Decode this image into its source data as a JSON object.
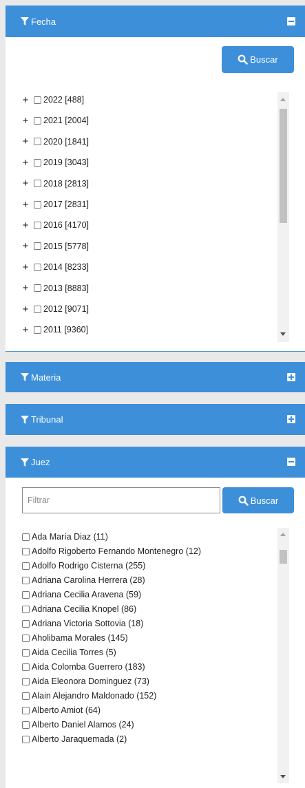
{
  "sections": {
    "fecha": {
      "title": "Fecha"
    },
    "materia": {
      "title": "Materia"
    },
    "tribunal": {
      "title": "Tribunal"
    },
    "juez": {
      "title": "Juez"
    }
  },
  "buscar_label": "Buscar",
  "juez_filter": {
    "placeholder": "Filtrar",
    "value": ""
  },
  "years": [
    {
      "label": "2022 [488]"
    },
    {
      "label": "2021 [2004]"
    },
    {
      "label": "2020 [1841]"
    },
    {
      "label": "2019 [3043]"
    },
    {
      "label": "2018 [2813]"
    },
    {
      "label": "2017 [2831]"
    },
    {
      "label": "2016 [4170]"
    },
    {
      "label": "2015 [5778]"
    },
    {
      "label": "2014 [8233]"
    },
    {
      "label": "2013 [8883]"
    },
    {
      "label": "2012 [9071]"
    },
    {
      "label": "2011 [9360]"
    }
  ],
  "judges": [
    {
      "label": "Ada María Diaz (11)"
    },
    {
      "label": "Adolfo Rigoberto Fernando Montenegro (12)"
    },
    {
      "label": "Adolfo Rodrigo Cisterna (255)"
    },
    {
      "label": "Adriana Carolina Herrera (28)"
    },
    {
      "label": "Adriana Cecilia Aravena (59)"
    },
    {
      "label": "Adriana Cecilia Knopel (86)"
    },
    {
      "label": "Adriana Victoria Sottovia (18)"
    },
    {
      "label": "Aholibama Morales (145)"
    },
    {
      "label": "Aida Cecilia Torres (5)"
    },
    {
      "label": "Aida Colomba Guerrero (183)"
    },
    {
      "label": "Aida Eleonora Dominguez (73)"
    },
    {
      "label": "Alain Alejandro Maldonado (152)"
    },
    {
      "label": "Alberto Amiot (64)"
    },
    {
      "label": "Alberto Daniel Alamos (24)"
    },
    {
      "label": "Alberto Jaraquemada (2)"
    }
  ],
  "colors": {
    "header": "#3d8fd9",
    "background": "#e9e9e9"
  },
  "icons": {
    "section": "funnel-icon",
    "expanded": "minus-square-icon",
    "collapsed": "plus-square-icon",
    "search": "magnifier-icon"
  }
}
